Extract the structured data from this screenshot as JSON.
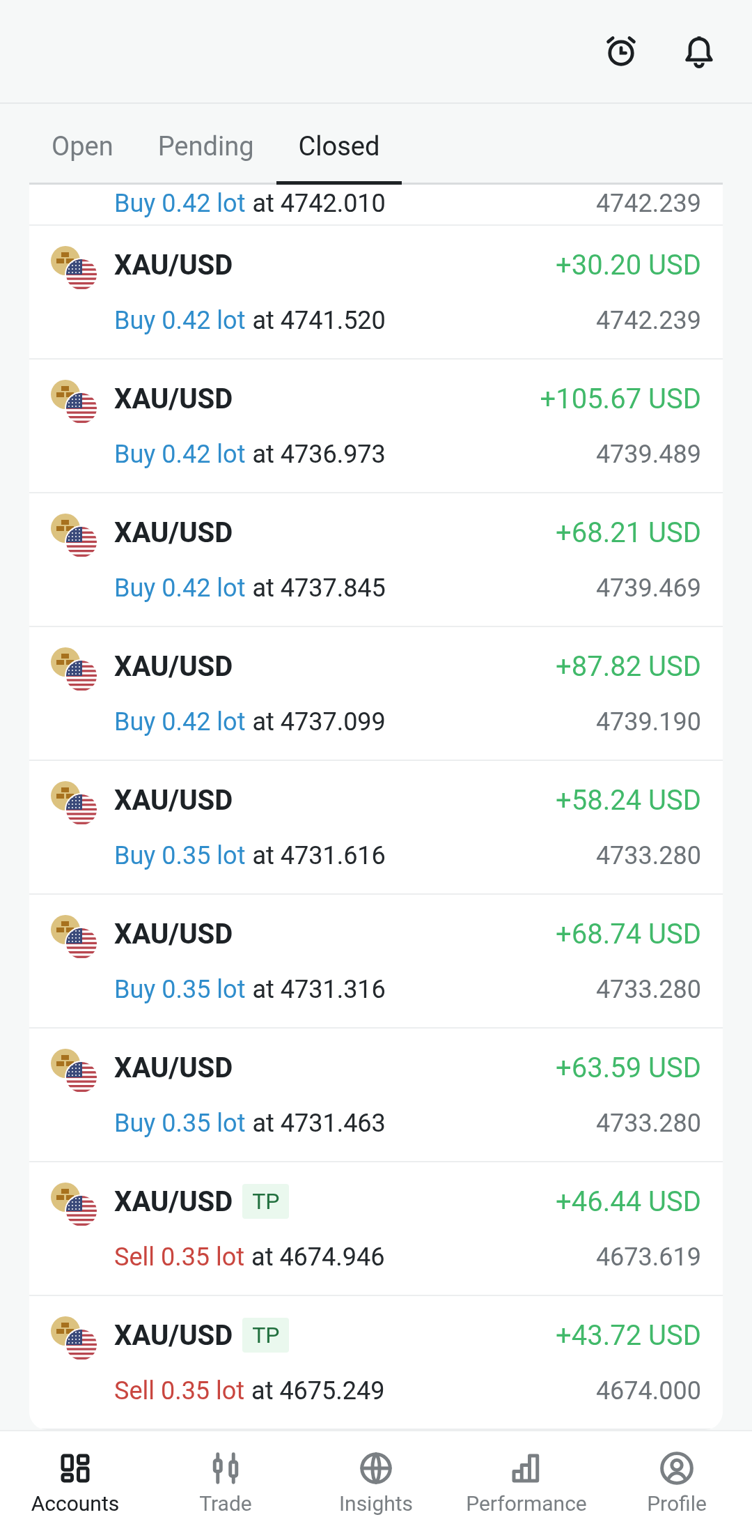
{
  "tabs": [
    {
      "label": "Open",
      "selected": false
    },
    {
      "label": "Pending",
      "selected": false
    },
    {
      "label": "Closed",
      "selected": true
    }
  ],
  "partial_trade": {
    "kind": "buy",
    "volume": "Buy 0.42 lot",
    "open_price": "at 4742.010",
    "close_price": "4742.239"
  },
  "trades": [
    {
      "pair": "XAU/USD",
      "kind": "buy",
      "volume": "Buy 0.42 lot",
      "open_price": "at 4741.520",
      "profit": "+30.20 USD",
      "close_price": "4742.239"
    },
    {
      "pair": "XAU/USD",
      "kind": "buy",
      "volume": "Buy 0.42 lot",
      "open_price": "at 4736.973",
      "profit": "+105.67 USD",
      "close_price": "4739.489"
    },
    {
      "pair": "XAU/USD",
      "kind": "buy",
      "volume": "Buy 0.42 lot",
      "open_price": "at 4737.845",
      "profit": "+68.21 USD",
      "close_price": "4739.469"
    },
    {
      "pair": "XAU/USD",
      "kind": "buy",
      "volume": "Buy 0.42 lot",
      "open_price": "at 4737.099",
      "profit": "+87.82 USD",
      "close_price": "4739.190"
    },
    {
      "pair": "XAU/USD",
      "kind": "buy",
      "volume": "Buy 0.35 lot",
      "open_price": "at 4731.616",
      "profit": "+58.24 USD",
      "close_price": "4733.280"
    },
    {
      "pair": "XAU/USD",
      "kind": "buy",
      "volume": "Buy 0.35 lot",
      "open_price": "at 4731.316",
      "profit": "+68.74 USD",
      "close_price": "4733.280"
    },
    {
      "pair": "XAU/USD",
      "kind": "buy",
      "volume": "Buy 0.35 lot",
      "open_price": "at 4731.463",
      "profit": "+63.59 USD",
      "close_price": "4733.280"
    },
    {
      "pair": "XAU/USD",
      "badge": "TP",
      "kind": "sell",
      "volume": "Sell 0.35 lot",
      "open_price": "at 4674.946",
      "profit": "+46.44 USD",
      "close_price": "4673.619"
    },
    {
      "pair": "XAU/USD",
      "badge": "TP",
      "kind": "sell",
      "volume": "Sell 0.35 lot",
      "open_price": "at 4675.249",
      "profit": "+43.72 USD",
      "close_price": "4674.000"
    }
  ],
  "nav": [
    {
      "kind": "accounts",
      "label": "Accounts",
      "selected": true
    },
    {
      "kind": "trade",
      "label": "Trade",
      "selected": false
    },
    {
      "kind": "insights",
      "label": "Insights",
      "selected": false
    },
    {
      "kind": "performance",
      "label": "Performance",
      "selected": false
    },
    {
      "kind": "profile",
      "label": "Profile",
      "selected": false
    }
  ]
}
